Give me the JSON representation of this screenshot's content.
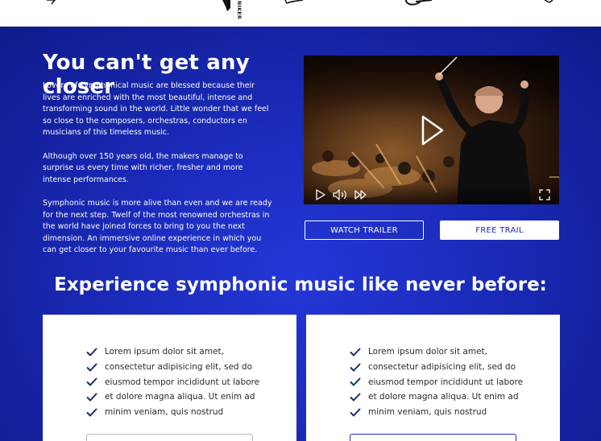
{
  "topbar": {
    "logos": [
      "logo-1",
      "logo-2",
      "logo-3",
      "logo-4",
      "logo-5"
    ],
    "vertical_logo_text": "NIKER"
  },
  "intro": {
    "title": "You can't get any closer",
    "paragraphs": [
      "Lovers of symphonical music are blessed because their lives are enriched with the most beautiful, intense and transforming sound in the world. Little wonder that we feel so close to the composers, orchestras, conductors en musicians of this timeless music.",
      "Although over 150 years old, the makers manage to surprise us every time with richer, fresher and more intense performances.",
      "Symphonic music is more alive than even and we are ready for the next step. Twelf of the most renowned orchestras in the world have joined forces to bring to you the next dimension. An immersive online experience in which you can get closer to your favourite music than ever before."
    ]
  },
  "video": {
    "icons": [
      "play-icon",
      "play-small-icon",
      "volume-icon",
      "fast-forward-icon",
      "fullscreen-icon"
    ]
  },
  "cta": {
    "watch_trailer": "WATCH TRAILER",
    "free_trail": "FREE TRAIL"
  },
  "section": {
    "title": "Experience symphonic music like never before:"
  },
  "cards": [
    {
      "features": [
        "Lorem ipsum dolor sit amet,",
        "consectetur adipisicing elit, sed do",
        "eiusmod tempor incididunt ut labore",
        "et dolore magna aliqua. Ut enim ad",
        "minim veniam, quis nostrud"
      ]
    },
    {
      "features": [
        "Lorem ipsum dolor sit amet,",
        "consectetur adipisicing elit, sed do",
        "eiusmod tempor incididunt ut labore",
        "et dolore magna aliqua. Ut enim ad",
        "minim veniam, quis nostrud"
      ]
    }
  ],
  "colors": {
    "brand_blue": "#1a2bb8",
    "white": "#ffffff",
    "check_navy": "#1b2a6b"
  }
}
